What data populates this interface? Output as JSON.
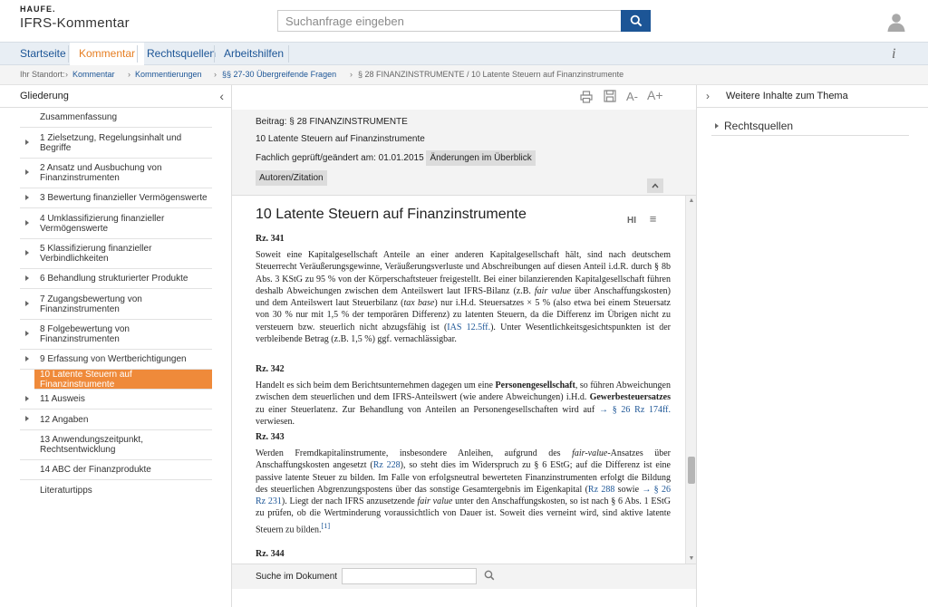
{
  "header": {
    "brand": "HAUFE.",
    "title": "IFRS-Kommentar",
    "search_placeholder": "Suchanfrage eingeben",
    "search_icon": "search-icon",
    "user_icon": "user-icon"
  },
  "nav": {
    "tabs": [
      {
        "label": "Startseite",
        "active": false
      },
      {
        "label": "Kommentar",
        "active": true
      },
      {
        "label": "Rechtsquellen",
        "active": false
      },
      {
        "label": "Arbeitshilfen",
        "active": false
      }
    ],
    "info_label": "i"
  },
  "breadcrumb": {
    "prefix": "Ihr Standort:",
    "items": [
      "Kommentar",
      "Kommentierungen",
      "§§ 27-30 Übergreifende Fragen",
      "§ 28 FINANZINSTRUMENTE / 10 Latente Steuern auf Finanzinstrumente"
    ],
    "separator": "›"
  },
  "left_panel": {
    "title": "Gliederung",
    "collapse": "‹",
    "items": [
      {
        "label": "Zusammenfassung",
        "arrow": false,
        "active": false
      },
      {
        "label": "1 Zielsetzung, Regelungsinhalt und Begriffe",
        "arrow": true,
        "active": false
      },
      {
        "label": "2 Ansatz und Ausbuchung von Finanzinstrumenten",
        "arrow": true,
        "active": false
      },
      {
        "label": "3 Bewertung finanzieller Vermögenswerte",
        "arrow": true,
        "active": false
      },
      {
        "label": "4 Umklassifizierung finanzieller Vermögenswerte",
        "arrow": true,
        "active": false
      },
      {
        "label": "5 Klassifizierung finanzieller Verbindlichkeiten",
        "arrow": true,
        "active": false
      },
      {
        "label": "6 Behandlung strukturierter Produkte",
        "arrow": true,
        "active": false
      },
      {
        "label": "7 Zugangsbewertung von Finanzinstrumenten",
        "arrow": true,
        "active": false
      },
      {
        "label": "8 Folgebewertung von Finanzinstrumenten",
        "arrow": true,
        "active": false
      },
      {
        "label": "9 Erfassung von Wertberichtigungen",
        "arrow": true,
        "active": false
      },
      {
        "label": "10 Latente Steuern auf Finanzinstrumente",
        "arrow": false,
        "active": true
      },
      {
        "label": "11 Ausweis",
        "arrow": true,
        "active": false
      },
      {
        "label": "12 Angaben",
        "arrow": true,
        "active": false
      },
      {
        "label": "13 Anwendungszeitpunkt, Rechtsentwicklung",
        "arrow": false,
        "active": false
      },
      {
        "label": "14 ABC der Finanzprodukte",
        "arrow": false,
        "active": false
      },
      {
        "label": "Literaturtipps",
        "arrow": false,
        "active": false
      }
    ]
  },
  "toolbar": {
    "print_icon": "print-icon",
    "save_icon": "save-icon",
    "font_smaller": "A-",
    "font_larger": "A+"
  },
  "meta": {
    "beitrag": "Beitrag:  § 28 FINANZINSTRUMENTE",
    "subtitle": "10 Latente Steuern auf Finanzinstrumente",
    "checked": "Fachlich geprüft/geändert am: 01.01.2015",
    "changes_btn": "Änderungen im Überblick",
    "authors_btn": "Autoren/Zitation"
  },
  "document": {
    "title": "10 Latente Steuern auf Finanzinstrumente",
    "tools_hi": "HI",
    "tools_menu": "≡",
    "rz341": "Rz. 341",
    "rz342": "Rz. 342",
    "rz343": "Rz. 343",
    "rz344": "Rz. 344",
    "footnote": "[1]"
  },
  "doc_search": {
    "label": "Suche im Dokument",
    "placeholder": ""
  },
  "right_panel": {
    "title": "Weitere Inhalte zum Thema",
    "collapse": "›",
    "item": "Rechtsquellen"
  }
}
